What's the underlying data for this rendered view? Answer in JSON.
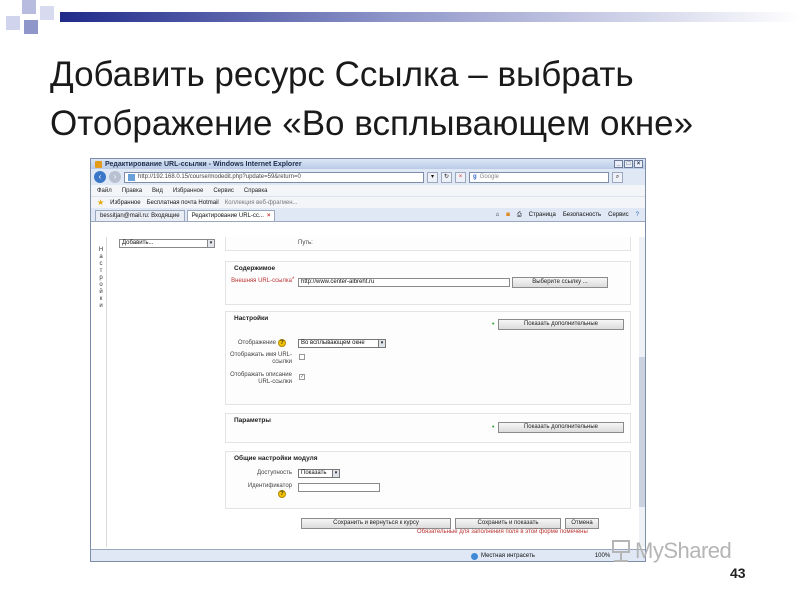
{
  "slide": {
    "title_line1": "Добавить ресурс Ссылка – выбрать",
    "title_line2": "Отображение «Во всплывающем окне»",
    "page_number": "43",
    "watermark": "MyShared"
  },
  "browser": {
    "window_title": "Редактирование URL-ссылки - Windows Internet Explorer",
    "address": "http://192.168.0.15/course/modedit.php?update=59&return=0",
    "search_placeholder": "Google",
    "menu": [
      "Файл",
      "Правка",
      "Вид",
      "Избранное",
      "Сервис",
      "Справка"
    ],
    "favorites_bar": {
      "favorites_label": "Избранное",
      "link1": "Бесплатная почта Hotmail",
      "link2": "Коллекция веб-фрагмен..."
    },
    "tabs": [
      {
        "label": "bessitjan@mail.ru: Входящие"
      },
      {
        "label": "Редактирование URL-сс..."
      }
    ],
    "tools": [
      "Страница",
      "Безопасность",
      "Сервис"
    ],
    "status": "Местная интрасеть",
    "zoom": "100%"
  },
  "page": {
    "left_vertical_label": "Настройки",
    "top_select": "Добавить...",
    "path_label": "Путь:",
    "content_section": {
      "title": "Содержимое",
      "url_label": "Внешняя URL-ссылка",
      "url_value": "http://www.center-albreht.ru",
      "choose_link_button": "Выберите ссылку ..."
    },
    "settings_section": {
      "title": "Настройки",
      "show_more_button": "Показать дополнительные",
      "display_label": "Отображение",
      "display_value": "Во всплывающем окне",
      "show_name_label": "Отображать имя URL-ссылки",
      "show_description_label": "Отображать описание URL-ссылки"
    },
    "params_section": {
      "title": "Параметры",
      "show_more_button": "Показать дополнительные"
    },
    "module_section": {
      "title": "Общие настройки модуля",
      "availability_label": "Доступность",
      "availability_value": "Показать",
      "id_label": "Идентификатор",
      "id_value": ""
    },
    "buttons": {
      "save_return": "Сохранить и вернуться к курсу",
      "save_show": "Сохранить и показать",
      "cancel": "Отмена"
    },
    "required_note": "Обязательные для заполнения поля в этой форме помечены"
  }
}
